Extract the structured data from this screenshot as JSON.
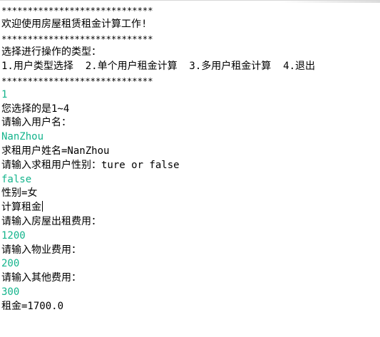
{
  "console": {
    "lines": [
      {
        "kind": "rule",
        "text": "*****************************"
      },
      {
        "kind": "output",
        "text": "欢迎使用房屋租赁租金计算工作!"
      },
      {
        "kind": "rule",
        "text": "*****************************"
      },
      {
        "kind": "output",
        "text": "选择进行操作的类型："
      },
      {
        "kind": "output",
        "text": "1.用户类型选择  2.单个用户租金计算  3.多用户租金计算  4.退出"
      },
      {
        "kind": "rule",
        "text": "*****************************"
      },
      {
        "kind": "input",
        "text": "1"
      },
      {
        "kind": "output",
        "text": "您选择的是1~4"
      },
      {
        "kind": "output",
        "text": "请输入用户名："
      },
      {
        "kind": "input",
        "text": "NanZhou"
      },
      {
        "kind": "output",
        "text": "求租用户姓名=NanZhou"
      },
      {
        "kind": "output",
        "text": "请输入求租用户性别：ture or false"
      },
      {
        "kind": "input",
        "text": "false"
      },
      {
        "kind": "output",
        "text": "性别=女"
      },
      {
        "kind": "output",
        "text": "计算租金"
      },
      {
        "kind": "output",
        "text": "请输入房屋出租费用："
      },
      {
        "kind": "input",
        "text": "1200"
      },
      {
        "kind": "output",
        "text": "请输入物业费用："
      },
      {
        "kind": "input",
        "text": "200"
      },
      {
        "kind": "output",
        "text": "请输入其他费用："
      },
      {
        "kind": "input",
        "text": "300"
      },
      {
        "kind": "output",
        "text": "租金=1700.0"
      }
    ],
    "colors": {
      "output": "#000000",
      "input": "#14b48c",
      "background": "#ffffff"
    }
  }
}
